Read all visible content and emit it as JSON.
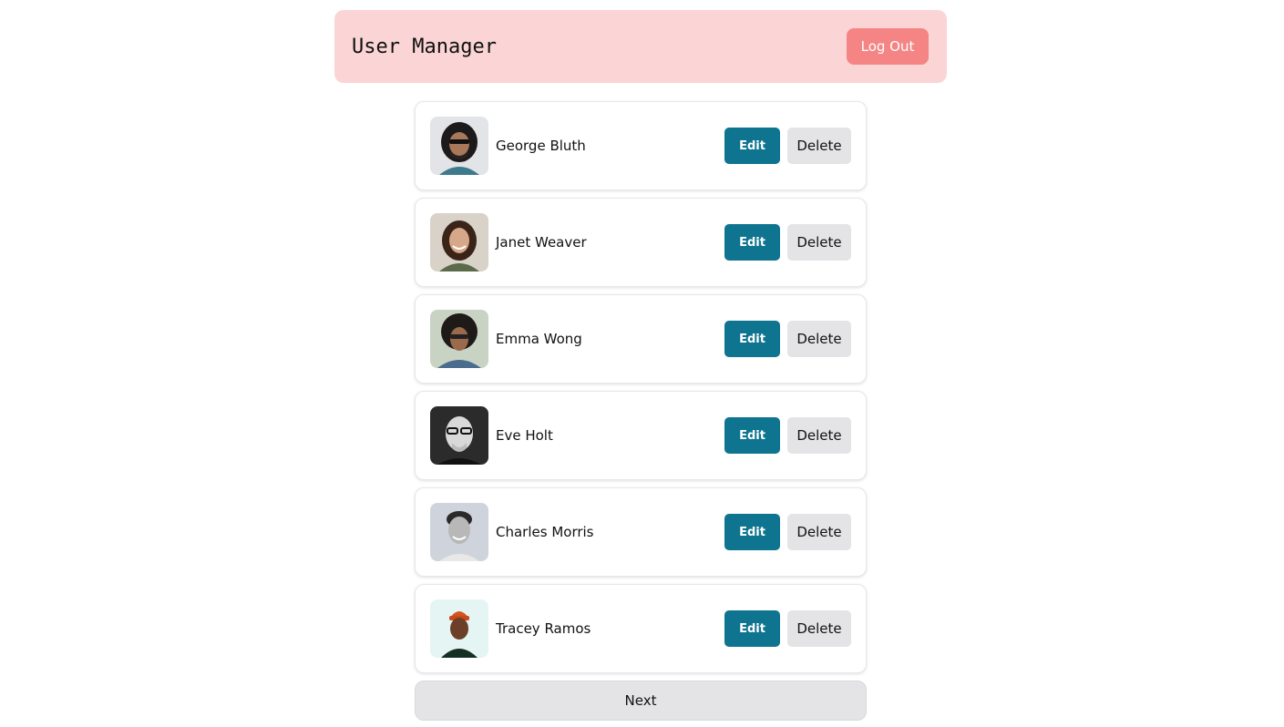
{
  "header": {
    "title": "User Manager",
    "logout_label": "Log Out"
  },
  "users": [
    {
      "name": "George Bluth",
      "edit_label": "Edit",
      "delete_label": "Delete"
    },
    {
      "name": "Janet Weaver",
      "edit_label": "Edit",
      "delete_label": "Delete"
    },
    {
      "name": "Emma Wong",
      "edit_label": "Edit",
      "delete_label": "Delete"
    },
    {
      "name": "Eve Holt",
      "edit_label": "Edit",
      "delete_label": "Delete"
    },
    {
      "name": "Charles Morris",
      "edit_label": "Edit",
      "delete_label": "Delete"
    },
    {
      "name": "Tracey Ramos",
      "edit_label": "Edit",
      "delete_label": "Delete"
    }
  ],
  "pagination": {
    "next_label": "Next"
  },
  "colors": {
    "header_bg": "#fbd5d5",
    "logout_bg": "#f58585",
    "edit_bg": "#0e7490",
    "delete_bg": "#e4e4e7"
  }
}
